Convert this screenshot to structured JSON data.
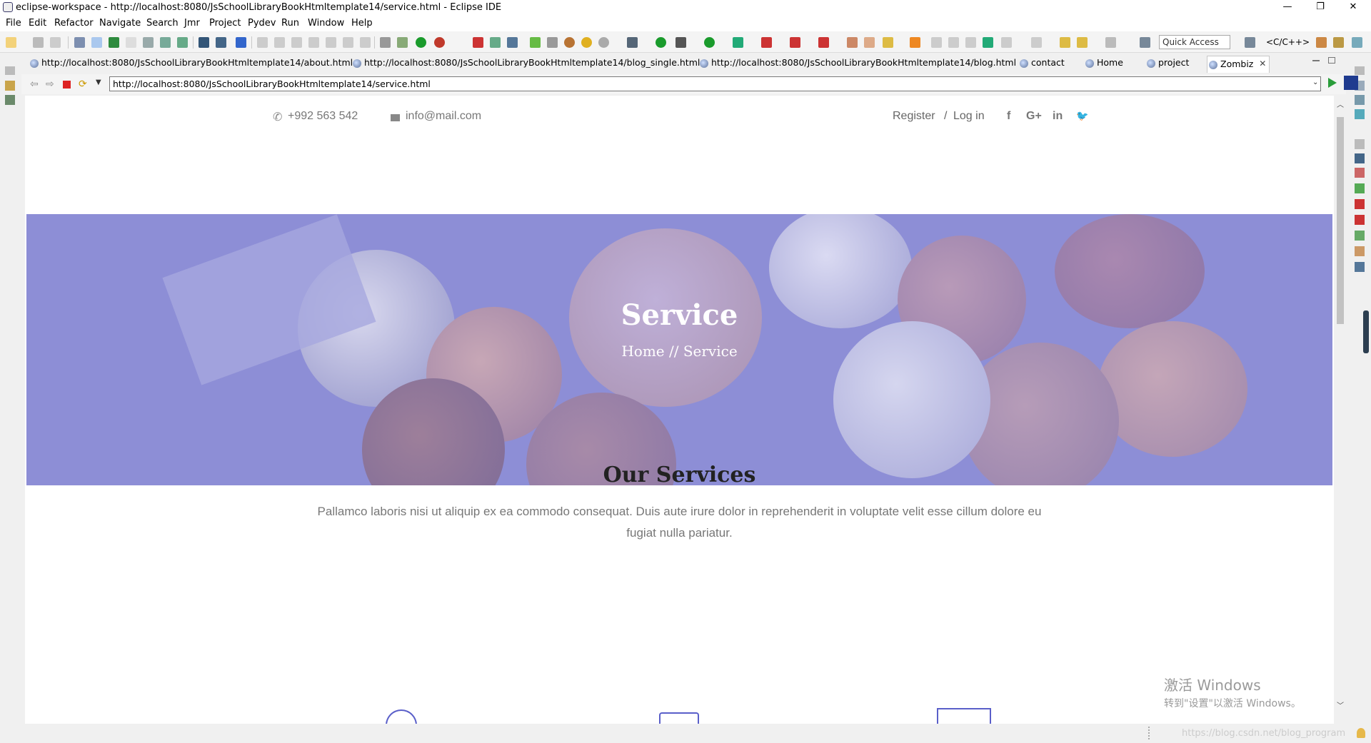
{
  "window": {
    "title": "eclipse-workspace - http://localhost:8080/JsSchoolLibraryBookHtmltemplate14/service.html - Eclipse IDE",
    "minimize": "—",
    "restore": "❐",
    "close": "✕"
  },
  "menu": [
    "File",
    "Edit",
    "Refactor",
    "Navigate",
    "Search",
    "Jmr",
    "Project",
    "Pydev",
    "Run",
    "Window",
    "Help"
  ],
  "toolbar": {
    "quick_access": "Quick Access",
    "perspective": "<C/C++>"
  },
  "tabs": [
    {
      "label": "http://localhost:8080/JsSchoolLibraryBookHtmltemplate14/about.html"
    },
    {
      "label": "http://localhost:8080/JsSchoolLibraryBookHtmltemplate14/blog_single.html"
    },
    {
      "label": "http://localhost:8080/JsSchoolLibraryBookHtmltemplate14/blog.html"
    },
    {
      "label": "contact"
    },
    {
      "label": "Home"
    },
    {
      "label": "project"
    },
    {
      "label": "Zombiz"
    }
  ],
  "browser": {
    "url": "http://localhost:8080/JsSchoolLibraryBookHtmltemplate14/service.html"
  },
  "page": {
    "phone": "+992 563 542",
    "email": "info@mail.com",
    "register": "Register",
    "sep": "/",
    "login": "Log in",
    "social": {
      "facebook": "f",
      "gplus": "G+",
      "linkedin": "in",
      "twitter": "🐦"
    },
    "hero_title": "Service",
    "breadcrumb": "Home // Service",
    "services_title": "Our Services",
    "services_desc": "Pallamco laboris nisi ut aliquip ex ea commodo consequat. Duis aute irure dolor in reprehenderit in voluptate velit esse cillum dolore eu fugiat nulla pariatur."
  },
  "watermark": {
    "line1": "激活 Windows",
    "line2": "转到\"设置\"以激活 Windows。",
    "csdn": "https://blog.csdn.net/blog_program"
  },
  "colors": {
    "hero_overlay": "#8d8ed6",
    "accent": "#5a5fc9"
  }
}
